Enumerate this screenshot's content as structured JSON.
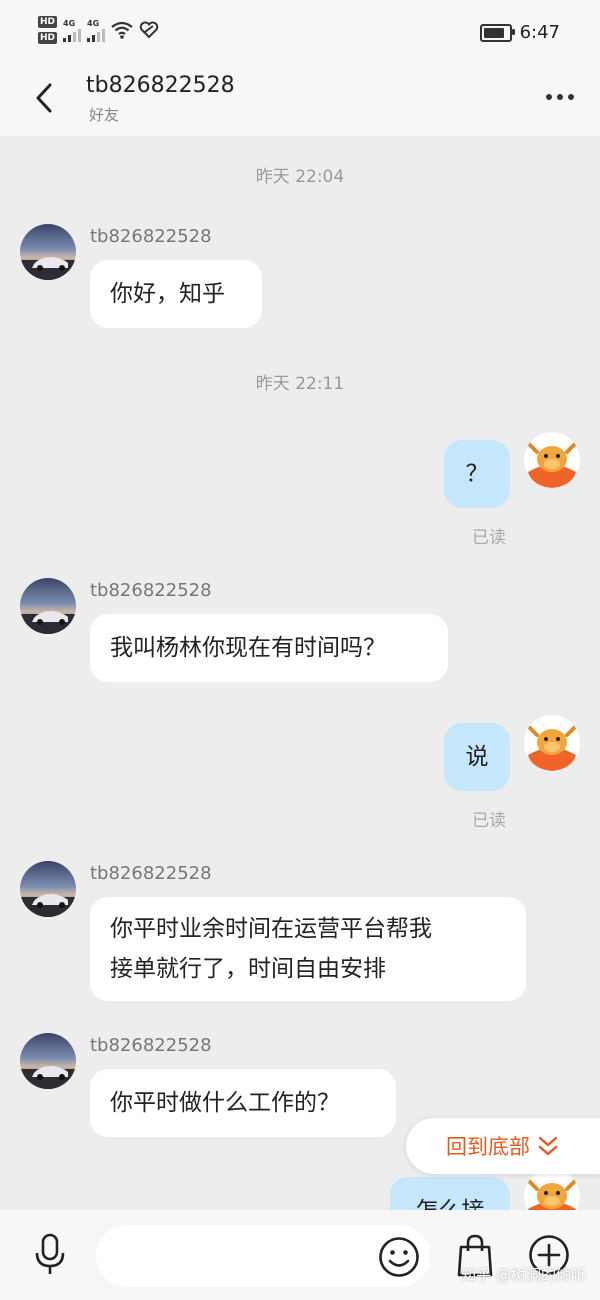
{
  "status_bar": {
    "sim1": "HD",
    "sim2": "HD",
    "net1": "4G",
    "net2": "4G",
    "time": "6:47",
    "battery_level": 0.85
  },
  "header": {
    "title": "tb826822528",
    "subtitle": "好友"
  },
  "messages": [
    {
      "time": "昨天  22:04"
    },
    {
      "sender": "tb826822528",
      "text": "你好，知乎"
    },
    {
      "time": "昨天  22:11"
    },
    {
      "text": "？",
      "status": "已读"
    },
    {
      "sender": "tb826822528",
      "text": "我叫杨林你现在有时间吗？"
    },
    {
      "text": "说",
      "status": "已读"
    },
    {
      "sender": "tb826822528",
      "line1": "你平时业余时间在运营平台帮我",
      "line2": "接单就行了，时间自由安排"
    },
    {
      "sender": "tb826822528",
      "text": "你平时做什么工作的？"
    },
    {
      "text": "怎么接"
    }
  ],
  "scroll_to_bottom": {
    "label": "回到底部"
  },
  "input_bar": {
    "watermark": "知乎 @树洞的倾听"
  },
  "colors": {
    "accent": "#e55a1c",
    "outgoing_bubble": "#c5e7fb",
    "background": "#ededed"
  }
}
